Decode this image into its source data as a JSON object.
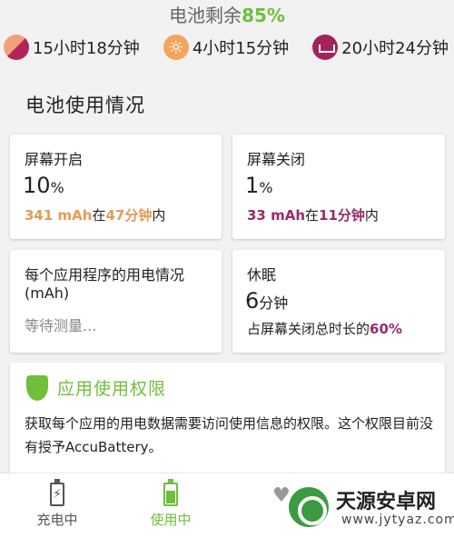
{
  "status": {
    "prefix": "电池剩余",
    "percent": "85%"
  },
  "estimates": [
    {
      "icon": "mixed-usage-icon",
      "text": "15小时18分钟"
    },
    {
      "icon": "sun-icon",
      "text": "4小时15分钟"
    },
    {
      "icon": "sleep-bed-icon",
      "text": "20小时24分钟"
    }
  ],
  "section_title": "电池使用情况",
  "screen_on": {
    "label": "屏幕开启",
    "value": "10",
    "unit": "%",
    "mah": "341 mAh",
    "in": "在",
    "duration": "47分钟",
    "within": "内"
  },
  "screen_off": {
    "label": "屏幕关闭",
    "value": "1",
    "unit": "%",
    "mah": "33 mAh",
    "in": "在",
    "duration": "11分钟",
    "within": "内"
  },
  "per_app": {
    "label_line1": "每个应用程序的用电情况",
    "label_line2": "(mAh)",
    "status": "等待测量..."
  },
  "deep_sleep": {
    "label": "休眠",
    "value": "6",
    "unit": "分钟",
    "desc": "占屏幕关闭总时长的",
    "percent": "60%"
  },
  "permission": {
    "title": "应用使用权限",
    "text": "获取每个应用的用电数据需要访问使用信息的权限。这个权限目前没有授予AccuBattery。"
  },
  "nav": {
    "charging": "充电中",
    "using": "使用中"
  },
  "watermark": {
    "name": "天源安卓网",
    "url": "www.jytyaz.com"
  },
  "colors": {
    "accent_green": "#6fbf3a",
    "screen_on_orange": "#e39a55",
    "screen_off_purple": "#9b2a6a"
  }
}
